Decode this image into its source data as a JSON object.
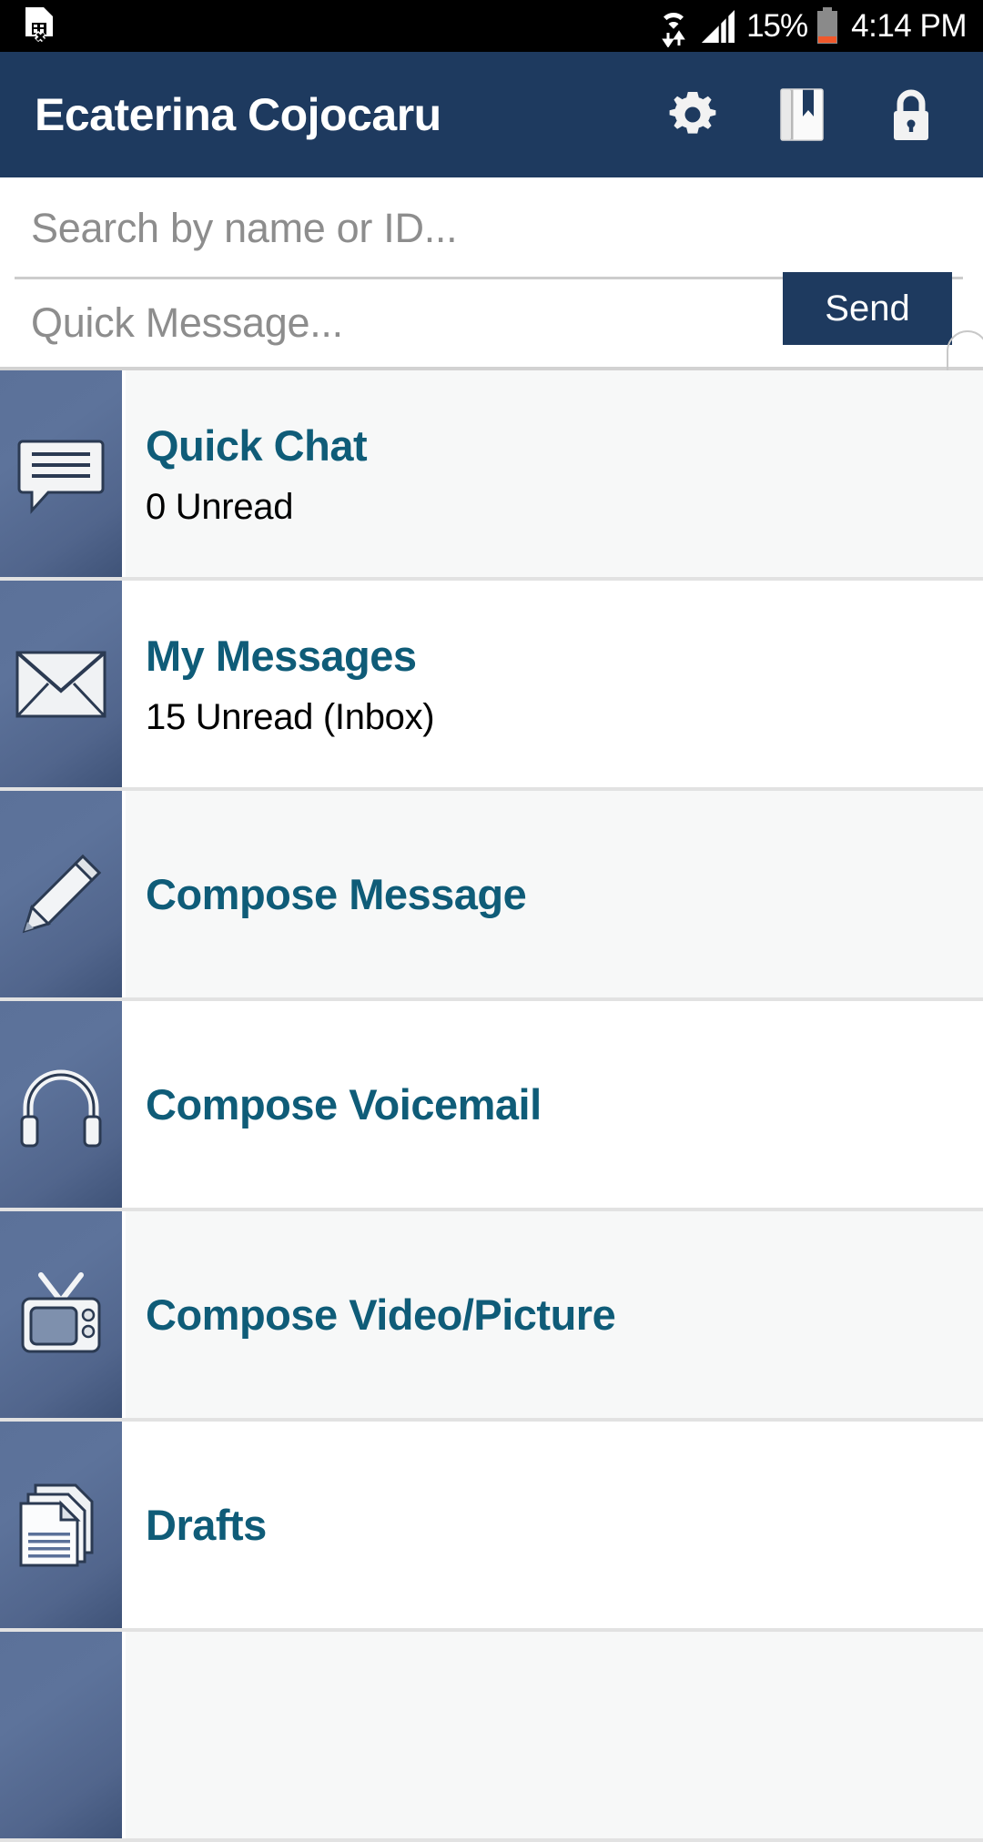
{
  "status_bar": {
    "sim_icon": "sim-card-error-icon",
    "wifi_icon": "wifi-transfer-icon",
    "signal_icon": "cellular-signal-icon",
    "battery_percent": "15%",
    "battery_icon": "battery-low-icon",
    "time": "4:14 PM"
  },
  "app_bar": {
    "title": "Ecaterina Cojocaru",
    "background_color": "#1e3a5f",
    "actions": [
      {
        "name": "settings",
        "icon": "gear-icon"
      },
      {
        "name": "bookmark",
        "icon": "bookmark-book-icon"
      },
      {
        "name": "lock",
        "icon": "lock-icon"
      }
    ]
  },
  "search": {
    "placeholder": "Search by name or ID...",
    "value": ""
  },
  "quick_message": {
    "placeholder": "Quick Message...",
    "value": "",
    "send_label": "Send",
    "send_color": "#1e3a5f"
  },
  "list": {
    "accent_color": "#0f5c78",
    "items": [
      {
        "title": "Quick Chat",
        "subtitle": "0 Unread",
        "icon": "chat-bubble-icon"
      },
      {
        "title": "My Messages",
        "subtitle": "15 Unread (Inbox)",
        "icon": "envelope-icon"
      },
      {
        "title": "Compose Message",
        "subtitle": "",
        "icon": "pencil-icon"
      },
      {
        "title": "Compose Voicemail",
        "subtitle": "",
        "icon": "headphones-icon"
      },
      {
        "title": "Compose Video/Picture",
        "subtitle": "",
        "icon": "television-icon"
      },
      {
        "title": "Drafts",
        "subtitle": "",
        "icon": "documents-stack-icon"
      }
    ]
  }
}
